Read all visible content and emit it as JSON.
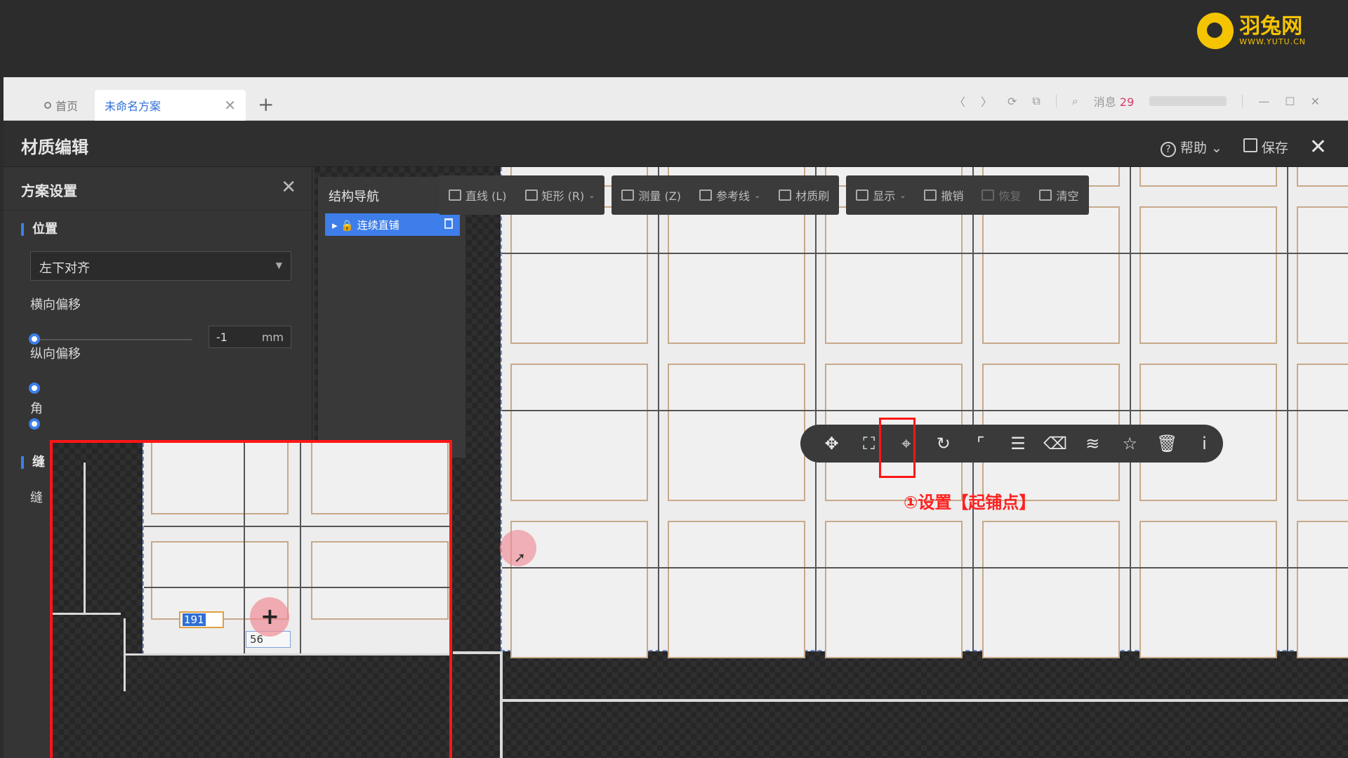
{
  "logo": {
    "cn": "羽兔网",
    "en": "WWW.YUTU.CN"
  },
  "browser": {
    "tabs": [
      {
        "label": "首页"
      },
      {
        "label": "未命名方案"
      }
    ],
    "add_tab": "+",
    "close_tab": "✕",
    "nav": {
      "back": "〈",
      "forward": "〉",
      "refresh": "⟳",
      "copy": "⧉",
      "search": "⌕"
    },
    "messages_label": "消息",
    "messages_count": "29",
    "window": {
      "minimize": "—",
      "maximize": "☐",
      "close": "✕"
    }
  },
  "header": {
    "title": "材质编辑",
    "help_label": "帮助",
    "save_label": "保存",
    "close": "✕"
  },
  "settings": {
    "title": "方案设置",
    "close": "✕",
    "position_section": "位置",
    "align_value": "左下对齐",
    "h_offset_label": "横向偏移",
    "h_offset_value": "-1",
    "h_offset_unit": "mm",
    "v_offset_label": "纵向偏移",
    "angle_label_partial": "角",
    "gap_section_partial": "缝",
    "gap_label_partial": "缝"
  },
  "structure_nav": {
    "title": "结构导航",
    "item": "连续直铺"
  },
  "toolbar": {
    "groups": [
      {
        "items": [
          {
            "label": "直线 (L)",
            "icon": "line-icon"
          },
          {
            "label": "矩形 (R)",
            "icon": "rect-icon",
            "caret": "⌄"
          }
        ]
      },
      {
        "items": [
          {
            "label": "测量 (Z)",
            "icon": "measure-icon"
          },
          {
            "label": "参考线",
            "icon": "guide-icon",
            "caret": "⌄"
          },
          {
            "label": "材质刷",
            "icon": "brush-icon"
          }
        ]
      },
      {
        "items": [
          {
            "label": "显示",
            "icon": "eye-icon",
            "caret": "⌄"
          },
          {
            "label": "撤销",
            "icon": "undo-icon"
          },
          {
            "label": "恢复",
            "icon": "redo-icon",
            "disabled": true
          },
          {
            "label": "清空",
            "icon": "eraser-icon"
          }
        ]
      }
    ]
  },
  "float_toolbar": {
    "buttons": [
      {
        "name": "move-icon",
        "glyph": "✥"
      },
      {
        "name": "select-move-icon",
        "glyph": "⛶"
      },
      {
        "name": "start-point-icon",
        "glyph": "⌖"
      },
      {
        "name": "rotate-icon",
        "glyph": "↻"
      },
      {
        "name": "align-corner-icon",
        "glyph": "⌜"
      },
      {
        "name": "stripe-icon",
        "glyph": "☰"
      },
      {
        "name": "eraser-icon",
        "glyph": "⌫"
      },
      {
        "name": "layers-icon",
        "glyph": "≋"
      },
      {
        "name": "star-icon",
        "glyph": "☆"
      },
      {
        "name": "delete-icon",
        "glyph": "🗑"
      },
      {
        "name": "info-icon",
        "glyph": "ⅰ"
      }
    ]
  },
  "annotation": "①设置【起铺点】",
  "inset": {
    "x_value": "191",
    "y_value": "56"
  },
  "colors": {
    "accent": "#3d7eea",
    "highlight": "#ff1616",
    "brand": "#f5c400"
  }
}
